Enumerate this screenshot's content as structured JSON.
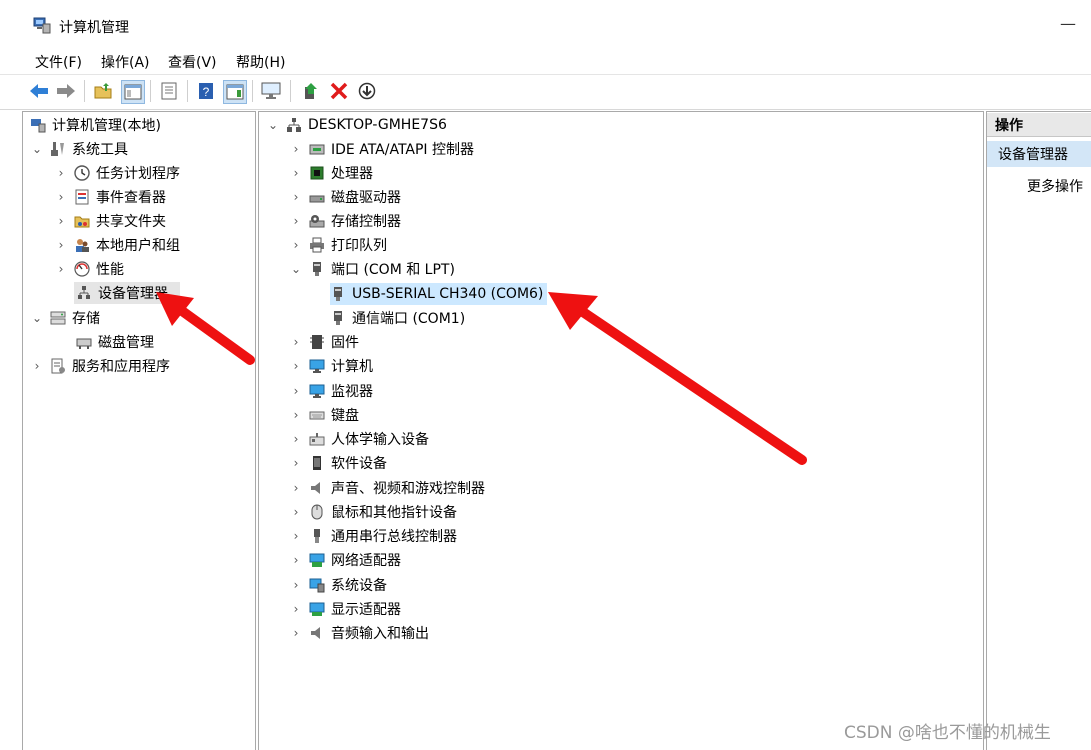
{
  "window": {
    "title": "计算机管理",
    "minimize_glyph": "—"
  },
  "menu": [
    "文件(F)",
    "操作(A)",
    "查看(V)",
    "帮助(H)"
  ],
  "toolbar": {
    "buttons": [
      "back-arrow-icon",
      "forward-arrow-icon",
      "up-folder-icon",
      "show-tree-icon",
      "export-list-icon",
      "help-icon",
      "action-pane-icon",
      "monitor-icon",
      "update-driver-icon",
      "uninstall-icon",
      "download-icon"
    ]
  },
  "left_tree": {
    "root": "计算机管理(本地)",
    "system_tools": "系统工具",
    "task_scheduler": "任务计划程序",
    "event_viewer": "事件查看器",
    "shared_folders": "共享文件夹",
    "local_users": "本地用户和组",
    "performance": "性能",
    "device_manager": "设备管理器",
    "storage": "存储",
    "disk_management": "磁盘管理",
    "services_apps": "服务和应用程序"
  },
  "device_tree": {
    "root": "DESKTOP-GMHE7S6",
    "categories": [
      "IDE ATA/ATAPI 控制器",
      "处理器",
      "磁盘驱动器",
      "存储控制器",
      "打印队列",
      "端口 (COM 和 LPT)",
      "固件",
      "计算机",
      "监视器",
      "键盘",
      "人体学输入设备",
      "软件设备",
      "声音、视频和游戏控制器",
      "鼠标和其他指针设备",
      "通用串行总线控制器",
      "网络适配器",
      "系统设备",
      "显示适配器",
      "音频输入和输出"
    ],
    "ports_children": [
      "USB-SERIAL CH340 (COM6)",
      "通信端口 (COM1)"
    ]
  },
  "actions": {
    "header": "操作",
    "device_manager": "设备管理器",
    "more": "更多操作"
  },
  "colors": {
    "selection": "#cce8ff",
    "arrow": "#ee1111",
    "action_selected": "#d3e6f7"
  },
  "watermark": "CSDN @啥也不懂的机械生"
}
